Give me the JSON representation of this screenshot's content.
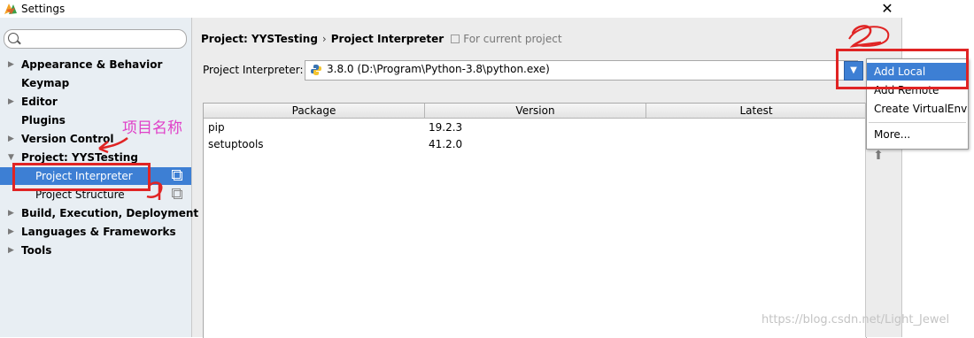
{
  "window": {
    "title": "Settings",
    "close_symbol": "✕"
  },
  "sidebar": {
    "search_placeholder": "",
    "items": [
      {
        "label": "Appearance & Behavior",
        "has_arrow": true
      },
      {
        "label": "Keymap",
        "has_arrow": false
      },
      {
        "label": "Editor",
        "has_arrow": true
      },
      {
        "label": "Plugins",
        "has_arrow": false
      },
      {
        "label": "Version Control",
        "has_arrow": true
      },
      {
        "label": "Project: YYSTesting",
        "has_arrow": true,
        "expanded": true
      },
      {
        "label": "Project Interpreter",
        "sub": true,
        "selected": true
      },
      {
        "label": "Project Structure",
        "sub": true
      },
      {
        "label": "Build, Execution, Deployment",
        "has_arrow": true
      },
      {
        "label": "Languages & Frameworks",
        "has_arrow": true
      },
      {
        "label": "Tools",
        "has_arrow": true
      }
    ]
  },
  "breadcrumb": {
    "project": "Project: YYSTesting",
    "separator": "›",
    "page": "Project Interpreter",
    "scope": "For current project"
  },
  "interpreter": {
    "label": "Project Interpreter:",
    "value": "3.8.0 (D:\\Program\\Python-3.8\\python.exe)"
  },
  "packages": {
    "columns": [
      "Package",
      "Version",
      "Latest"
    ],
    "rows": [
      {
        "package": "pip",
        "version": "19.2.3",
        "latest": ""
      },
      {
        "package": "setuptools",
        "version": "41.2.0",
        "latest": ""
      }
    ]
  },
  "popup_menu": {
    "items": [
      "Add Local",
      "Add Remote",
      "Create VirtualEnv",
      "More..."
    ],
    "selected_index": 0
  },
  "annotations": {
    "cn_label": "项目名称",
    "marker_1": "1",
    "marker_2": "2"
  },
  "watermark": "https://blog.csdn.net/Light_Jewel",
  "colors": {
    "accent": "#3d7fd4",
    "annotation_red": "#e02424",
    "annotation_pink": "#e040c8"
  }
}
